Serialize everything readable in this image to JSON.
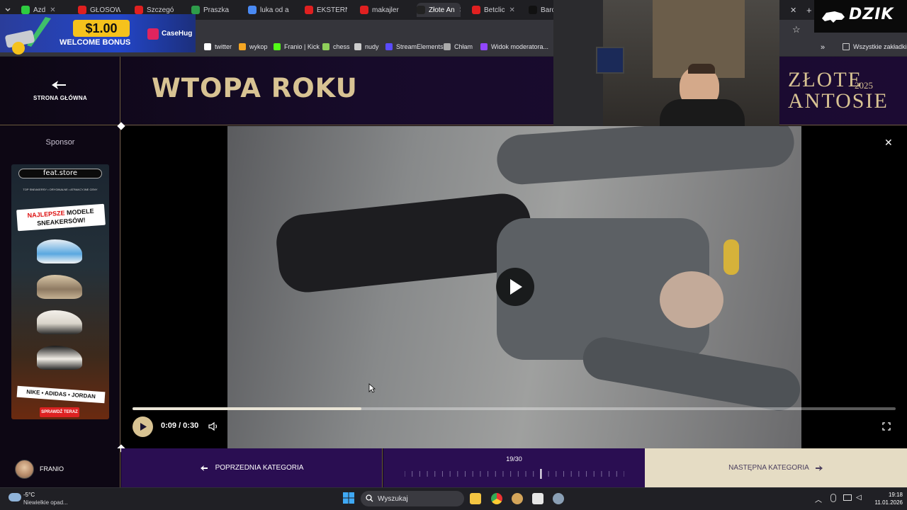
{
  "browser": {
    "tabs": [
      {
        "label": "Azd",
        "color": "#2ecc40"
      },
      {
        "label": "GŁOSOW",
        "color": "#e02020"
      },
      {
        "label": "Szczegó",
        "color": "#e02020"
      },
      {
        "label": "Praszka",
        "color": "#2e9c4a"
      },
      {
        "label": "luka od a",
        "color": "#4a8af4"
      },
      {
        "label": "EKSTERN",
        "color": "#e02020"
      },
      {
        "label": "makajler",
        "color": "#e02020"
      },
      {
        "label": "Złote An",
        "color": "#222222"
      },
      {
        "label": "Betclic",
        "color": "#e02020"
      },
      {
        "label": "Barca",
        "color": "#111111"
      }
    ],
    "bookmarks": [
      {
        "label": "twitter",
        "icon": "x-icon"
      },
      {
        "label": "wykop",
        "icon": "wykop-icon"
      },
      {
        "label": "Franio | Kick",
        "icon": "kick-icon"
      },
      {
        "label": "chess",
        "icon": "chess-icon"
      },
      {
        "label": "nudy",
        "icon": "folder-icon"
      },
      {
        "label": "StreamElements",
        "icon": "streamelements-icon"
      },
      {
        "label": "Chłam",
        "icon": "globe-icon"
      },
      {
        "label": "Widok moderatora...",
        "icon": "twitch-icon"
      }
    ],
    "all_bookmarks": "Wszystkie zakładki"
  },
  "header": {
    "home_label": "STRONA GŁÓWNA",
    "category_title": "WTOPA ROKU",
    "logo_line1": "ZŁOTE",
    "logo_line2": "ANTOSIE",
    "logo_year": "2025"
  },
  "sidebar": {
    "sponsor_label": "Sponsor",
    "ad": {
      "store": "feat.store",
      "tagline": "TOP SNEAKERSY • ORYGINALNE • ATRAKCYJNE CENY",
      "headline_red": "NAJLEPSZE",
      "headline_rest": "MODELE SNEAKERSÓW!",
      "brands": "NIKE • ADIDAS • JORDAN",
      "cta": "SPRAWDŹ TERAZ"
    }
  },
  "player": {
    "time_current": "0:09",
    "time_total": "0:30",
    "time_display": "0:09 / 0:30",
    "progress_fraction": 0.3
  },
  "bottom_nav": {
    "username": "FRANIO",
    "prev_label": "POPRZEDNIA KATEGORIA",
    "category_counter": "19/30",
    "category_current": 19,
    "category_total": 30,
    "next_label": "NASTĘPNA KATEGORIA"
  },
  "taskbar": {
    "weather_temp": "-5°C",
    "weather_desc": "Niewielkie opad...",
    "search_placeholder": "Wyszukaj",
    "time": "19:18",
    "date": "11.01.2026"
  },
  "overlay": {
    "bonus_amount": "$1.00",
    "bonus_text": "WELCOME BONUS",
    "casehug_label": "CaseHug",
    "dzik_label": "DZIK"
  },
  "colors": {
    "gold": "#d8c393",
    "purple": "#2a0e52",
    "cream": "#e5dcc4"
  }
}
